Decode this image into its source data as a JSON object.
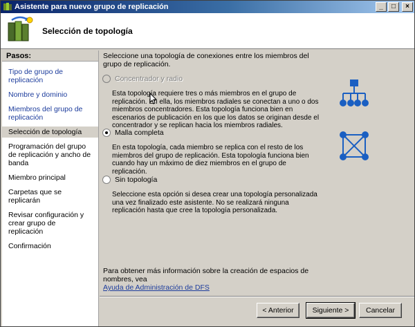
{
  "window": {
    "title": "Asistente para nuevo grupo de replicación"
  },
  "header": {
    "title": "Selección de topología"
  },
  "sidebar": {
    "heading": "Pasos:",
    "steps": [
      {
        "label": "Tipo de grupo de replicación",
        "state": "link"
      },
      {
        "label": "Nombre y dominio",
        "state": "link"
      },
      {
        "label": "Miembros del grupo de replicación",
        "state": "link"
      },
      {
        "label": "Selección de topología",
        "state": "current"
      },
      {
        "label": "Programación del grupo de replicación y ancho de banda",
        "state": "plain"
      },
      {
        "label": "Miembro principal",
        "state": "plain"
      },
      {
        "label": "Carpetas que se replicarán",
        "state": "plain"
      },
      {
        "label": "Revisar configuración y crear grupo de replicación",
        "state": "plain"
      },
      {
        "label": "Confirmación",
        "state": "plain"
      }
    ]
  },
  "main": {
    "intro": "Seleccione una topología de conexiones entre los miembros del grupo de replicación.",
    "options": [
      {
        "label": "Concentrador y radio",
        "selected": false,
        "disabled": true,
        "description": "Esta topología requiere tres o más miembros en el grupo de replicación. En ella, los miembros radiales se conectan a uno o dos miembros concentradores. Esta topología funciona bien en escenarios de publicación en los que los datos se originan desde el concentrador y se replican hacia los miembros radiales.",
        "icon": "hub-spoke-icon"
      },
      {
        "label": "Malla completa",
        "selected": true,
        "disabled": false,
        "description": "En esta topología, cada miembro se replica con el resto de los miembros del grupo de replicación. Esta topología funciona bien cuando hay un máximo de diez miembros en el grupo de replicación.",
        "icon": "full-mesh-icon"
      },
      {
        "label": "Sin topología",
        "selected": false,
        "disabled": false,
        "description": "Seleccione esta opción si desea crear una topología personalizada una vez finalizado este asistente. No se realizará ninguna replicación hasta que cree la topología personalizada."
      }
    ],
    "help_text": "Para obtener más información sobre la creación de espacios de nombres, vea",
    "help_link": "Ayuda de Administración de DFS"
  },
  "buttons": {
    "back": "< Anterior",
    "next": "Siguiente >",
    "cancel": "Cancelar"
  },
  "colors": {
    "link": "#1c3c9c",
    "icon_blue": "#1a5fc2",
    "title_start": "#0a246a"
  }
}
